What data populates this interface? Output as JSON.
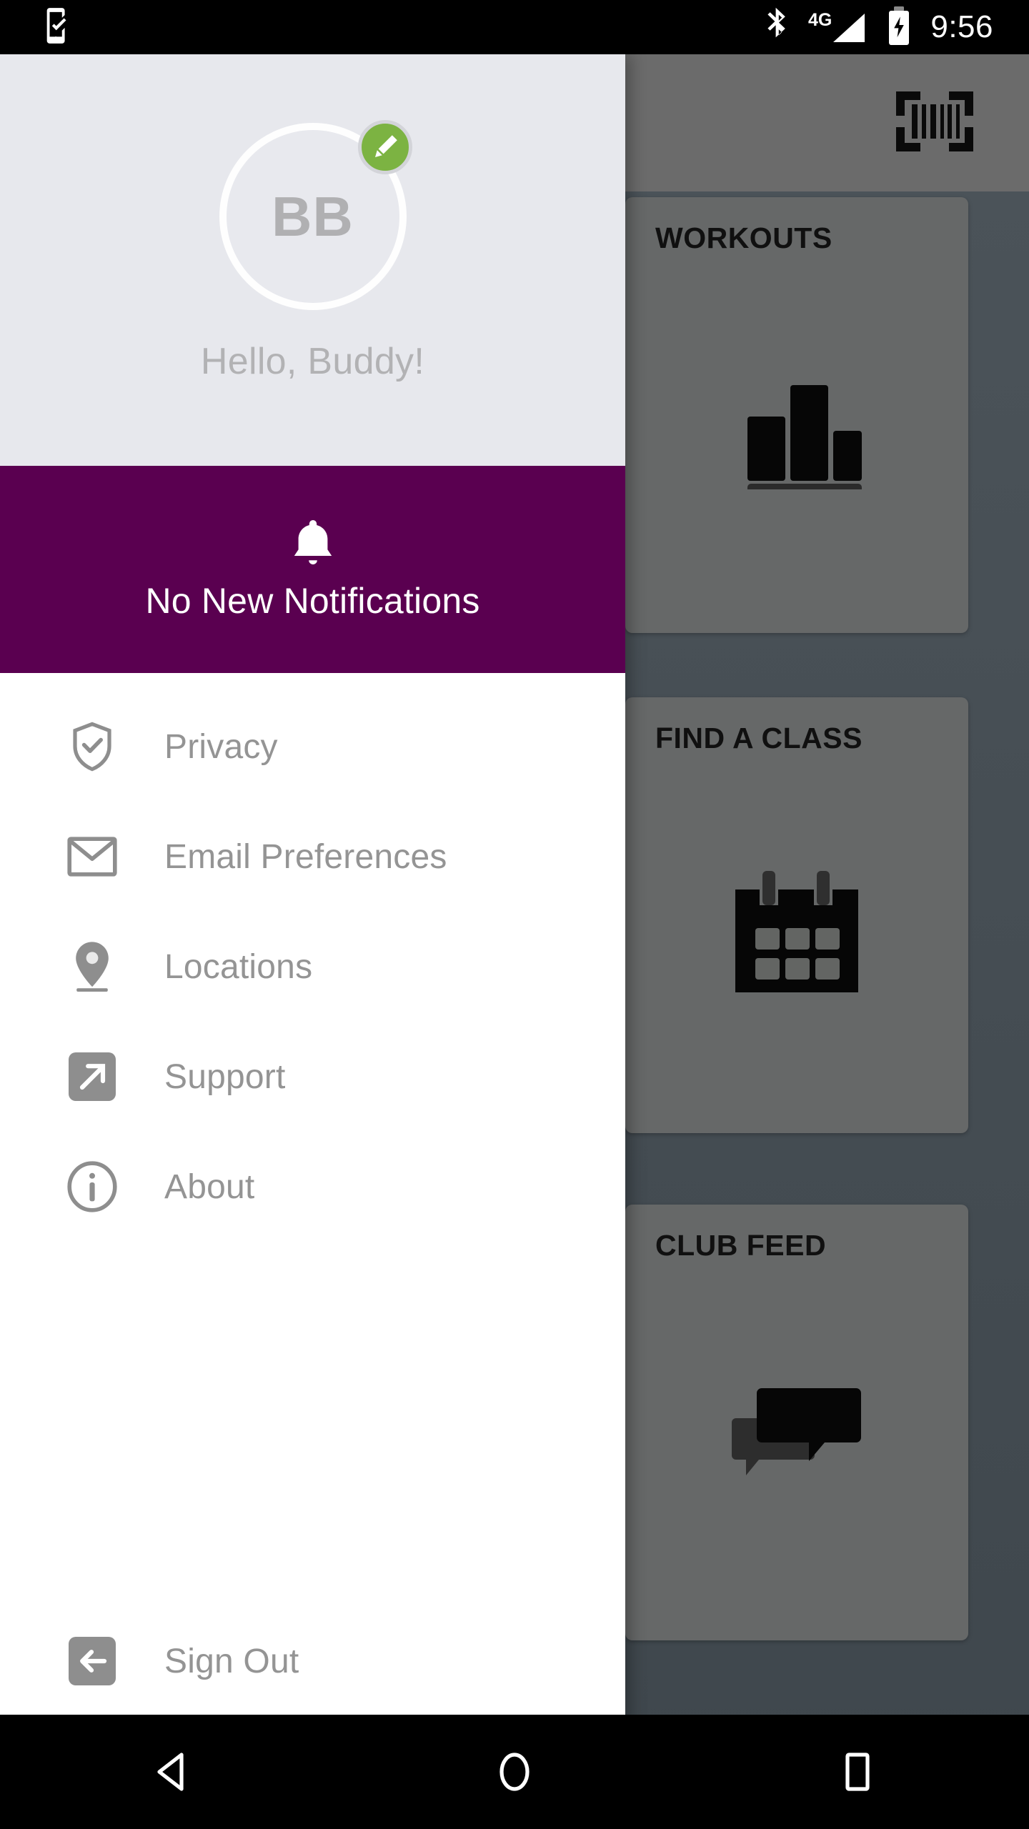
{
  "status_bar": {
    "app_icon": "phone-check-icon",
    "bluetooth_icon": "bluetooth-icon",
    "network_label": "4G",
    "signal_icon": "signal-bars-icon",
    "battery_icon": "battery-charging-icon",
    "time": "9:56"
  },
  "drawer": {
    "profile": {
      "avatar_initials": "BB",
      "edit_badge_icon": "pencil-edit-icon",
      "greeting": "Hello, Buddy!"
    },
    "notification": {
      "icon": "bell-icon",
      "label": "No New Notifications"
    },
    "menu_items": [
      {
        "label": "Privacy",
        "icon": "shield-check-icon"
      },
      {
        "label": "Email Preferences",
        "icon": "envelope-icon"
      },
      {
        "label": "Locations",
        "icon": "map-pin-icon"
      },
      {
        "label": "Support",
        "icon": "external-link-icon"
      },
      {
        "label": "About",
        "icon": "info-circle-icon"
      }
    ],
    "sign_out": {
      "label": "Sign Out",
      "icon": "sign-out-arrow-icon"
    }
  },
  "app_background": {
    "header": {
      "scan_icon": "barcode-scan-icon"
    },
    "cards": [
      {
        "title": "WORKOUTS",
        "icon": "bar-chart-icon"
      },
      {
        "title": "FIND A CLASS",
        "icon": "calendar-icon"
      },
      {
        "title": "CLUB FEED",
        "icon": "chat-bubbles-icon"
      }
    ]
  },
  "nav_bar": {
    "back": "back-triangle-icon",
    "home": "home-circle-icon",
    "recents": "recents-square-icon"
  },
  "colors": {
    "accent_purple": "#5A0050",
    "edit_badge_green": "#7CB342",
    "profile_bg": "#E7E8ED",
    "drawer_bg": "#FFFFFF",
    "menu_text": "#949494",
    "scrim": "rgba(0,0,0,0.45)"
  }
}
